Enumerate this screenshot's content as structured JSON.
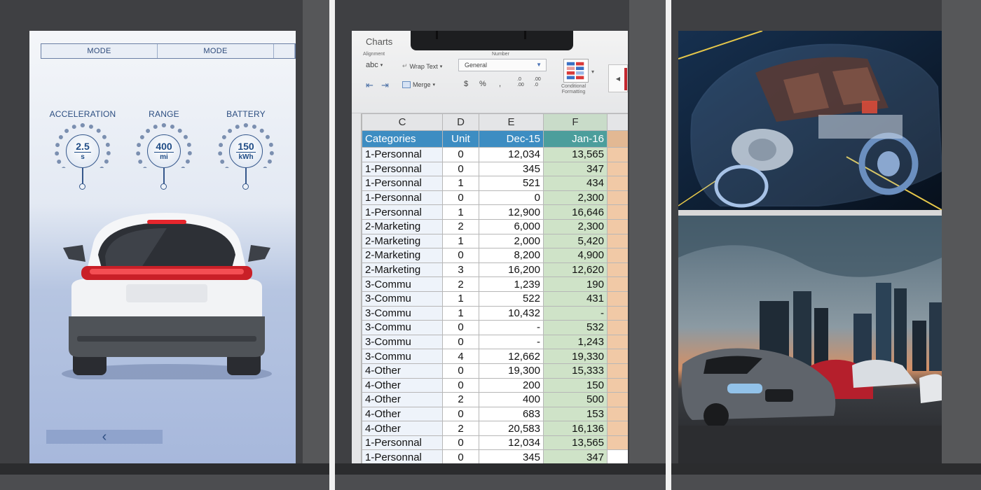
{
  "dashboard": {
    "mode_tabs": [
      "MODE",
      "MODE"
    ],
    "gauges": [
      {
        "label": "ACCELERATION",
        "value": "2.5",
        "unit": "s"
      },
      {
        "label": "RANGE",
        "value": "400",
        "unit": "mi"
      },
      {
        "label": "BATTERY",
        "value": "150",
        "unit": "kWh"
      }
    ],
    "back_glyph": "‹",
    "colors": {
      "accent": "#1f4c86",
      "tail_light": "#d9262c"
    }
  },
  "spreadsheet": {
    "ribbon": {
      "tab_label": "Charts",
      "alignment_label": "Alignment",
      "number_label": "Number",
      "abc_label": "abc",
      "wrap_text_label": "Wrap Text",
      "merge_label": "Merge",
      "number_format": "General",
      "currency_symbol": "$",
      "percent_symbol": "%",
      "comma_symbol": ",",
      "decimal_increase": ".0\n.00",
      "decimal_decrease": ".00\n.0",
      "conditional_formatting_label": "Conditional\nFormatting"
    },
    "column_letters": [
      "C",
      "D",
      "E",
      "F"
    ],
    "headers": [
      "Categories",
      "Unit",
      "Dec-15",
      "Jan-16"
    ],
    "rows": [
      [
        "1-Personnal",
        "0",
        "12,034",
        "13,565"
      ],
      [
        "1-Personnal",
        "0",
        "345",
        "347"
      ],
      [
        "1-Personnal",
        "1",
        "521",
        "434"
      ],
      [
        "1-Personnal",
        "0",
        "0",
        "2,300"
      ],
      [
        "1-Personnal",
        "1",
        "12,900",
        "16,646"
      ],
      [
        "2-Marketing",
        "2",
        "6,000",
        "2,300"
      ],
      [
        "2-Marketing",
        "1",
        "2,000",
        "5,420"
      ],
      [
        "2-Marketing",
        "0",
        "8,200",
        "4,900"
      ],
      [
        "2-Marketing",
        "3",
        "16,200",
        "12,620"
      ],
      [
        "3-Commu",
        "2",
        "1,239",
        "190"
      ],
      [
        "3-Commu",
        "1",
        "522",
        "431"
      ],
      [
        "3-Commu",
        "1",
        "10,432",
        "-"
      ],
      [
        "3-Commu",
        "0",
        "-",
        "532"
      ],
      [
        "3-Commu",
        "0",
        "-",
        "1,243"
      ],
      [
        "3-Commu",
        "4",
        "12,662",
        "19,330"
      ],
      [
        "4-Other",
        "0",
        "19,300",
        "15,333"
      ],
      [
        "4-Other",
        "0",
        "200",
        "150"
      ],
      [
        "4-Other",
        "2",
        "400",
        "500"
      ],
      [
        "4-Other",
        "0",
        "683",
        "153"
      ],
      [
        "4-Other",
        "2",
        "20,583",
        "16,136"
      ],
      [
        "1-Personnal",
        "0",
        "12,034",
        "13,565"
      ],
      [
        "1-Personnal",
        "0",
        "345",
        "347"
      ]
    ],
    "colors": {
      "header_blue": "#3d8dc2",
      "jan_green": "#cfe3c8",
      "extra_orange": "#f1c9a6"
    }
  },
  "photos": {
    "top_icon": "car-xray-icon",
    "bottom_icon": "cars-city-icon"
  }
}
